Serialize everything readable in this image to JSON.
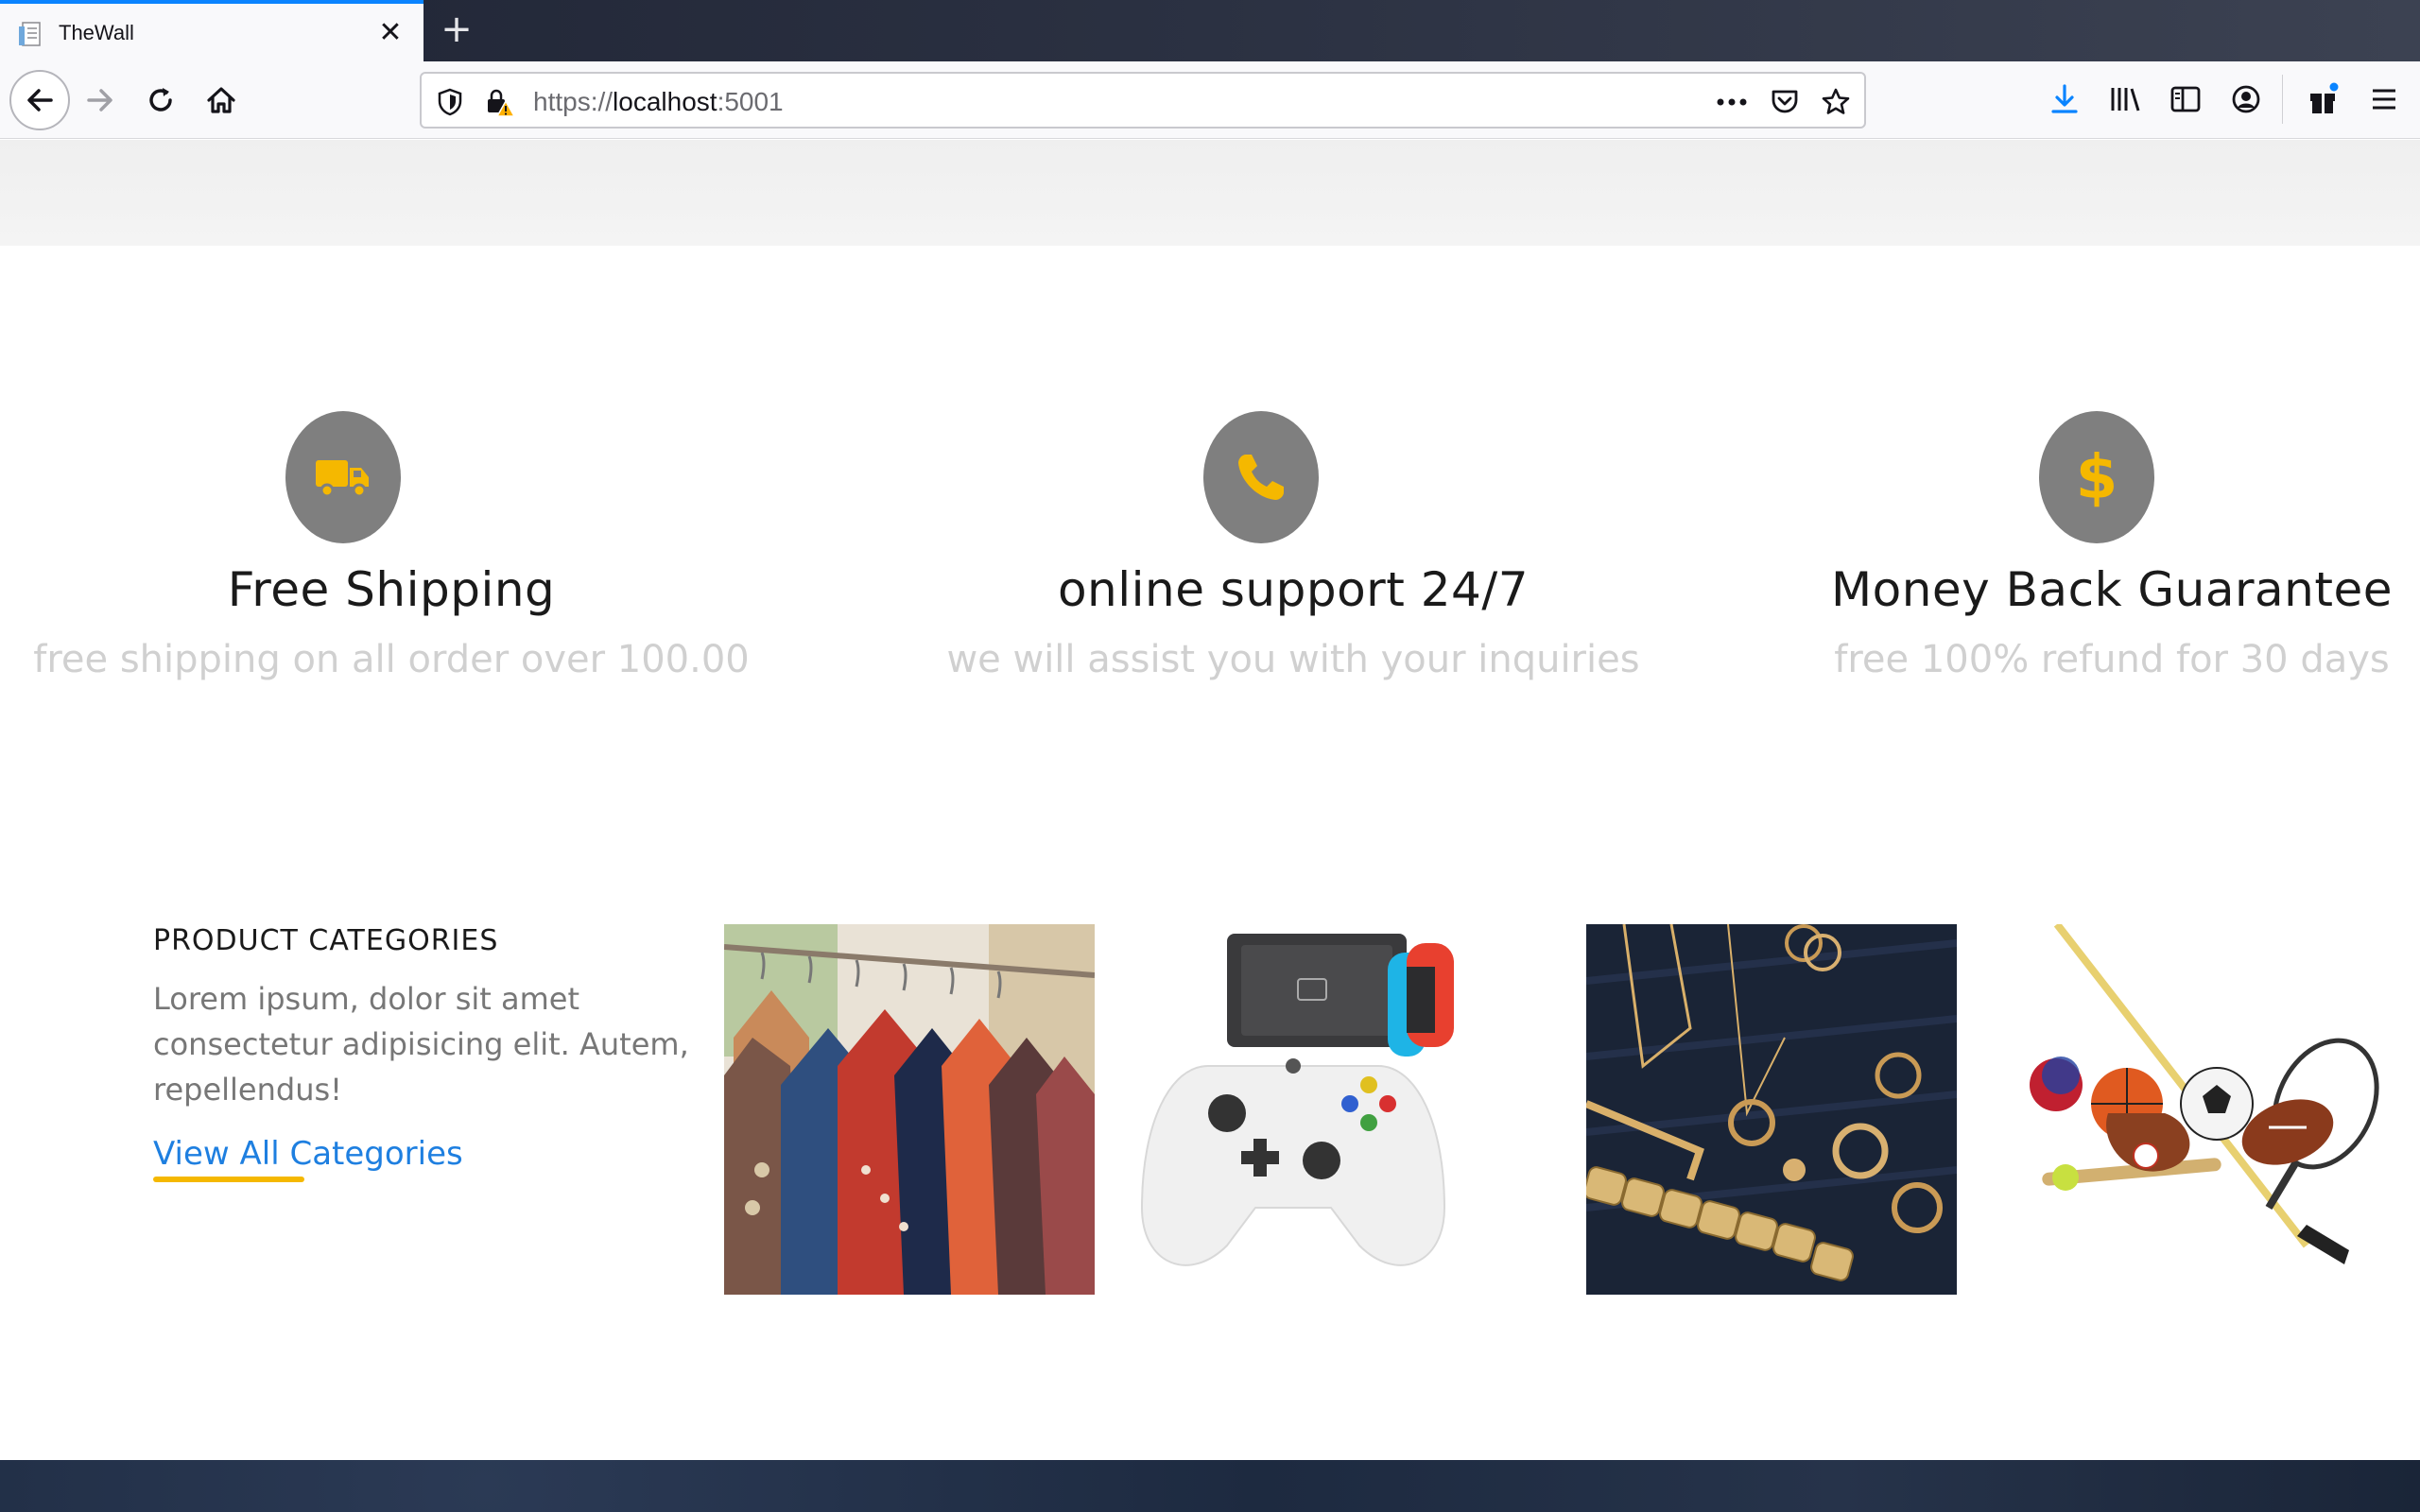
{
  "browser": {
    "tab_title": "TheWall",
    "url_scheme": "https://",
    "url_host": "localhost",
    "url_port": ":5001",
    "accent": "#0a84ff"
  },
  "icons": {
    "back": "back-arrow-icon",
    "forward": "forward-arrow-icon",
    "reload": "reload-icon",
    "home": "home-icon",
    "shield": "tracking-shield-icon",
    "lock": "insecure-lock-icon",
    "more": "page-actions-icon",
    "pocket": "pocket-icon",
    "bookmark": "bookmark-star-icon",
    "download": "download-icon",
    "library": "library-icon",
    "sidebar": "sidebar-icon",
    "account": "account-icon",
    "whatsnew": "gift-icon",
    "menu": "hamburger-menu-icon"
  },
  "features": [
    {
      "icon": "truck-icon",
      "title": "Free Shipping",
      "subtitle": "free shipping on all order over 100.00"
    },
    {
      "icon": "phone-icon",
      "title": "online support 24/7",
      "subtitle": "we will assist you with your inquiries"
    },
    {
      "icon": "dollar-icon",
      "title": "Money Back Guarantee",
      "subtitle": "free 100% refund for 30 days"
    }
  ],
  "categories": {
    "heading": "PRODUCT CATEGORIES",
    "description": "Lorem ipsum, dolor sit amet consectetur adipisicing elit. Autem, repellendus!",
    "link": "View All Categories",
    "images": [
      "clothing-rack-image",
      "game-console-image",
      "jewelry-image",
      "sports-equipment-image"
    ]
  },
  "colors": {
    "icon_circle": "#7f7f7f",
    "icon_accent": "#f5b800",
    "link": "#1e7fe0",
    "muted_text": "#d0d0d0"
  }
}
